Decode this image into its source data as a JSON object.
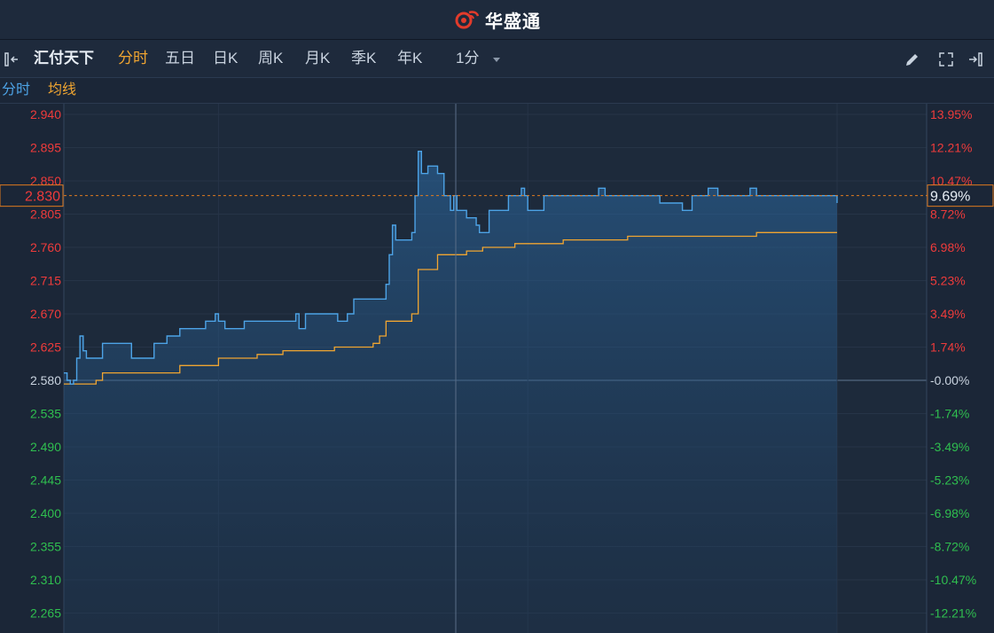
{
  "header": {
    "logo_text": "华盛通"
  },
  "toolbar": {
    "stock_name": "汇付天下",
    "tabs": [
      "分时",
      "五日",
      "日K",
      "周K",
      "月K",
      "季K",
      "年K"
    ],
    "active_tab": "分时",
    "interval": "1分"
  },
  "legend": {
    "price_label": "分时",
    "avg_label": "均线"
  },
  "colors": {
    "up": "#ef3b3b",
    "down": "#2fbf4f",
    "price_line": "#4da3e6",
    "avg_line": "#f0a531",
    "background": "#1b2637"
  },
  "chart_data": {
    "type": "line",
    "prev_close": 2.58,
    "current_price_label": "2.830",
    "current_pct_label": "9.69%",
    "y_tick_labels": [
      "2.940",
      "2.895",
      "2.850",
      "2.805",
      "2.760",
      "2.715",
      "2.670",
      "2.625",
      "2.580",
      "2.535",
      "2.490",
      "2.445",
      "2.400",
      "2.355",
      "2.310",
      "2.265"
    ],
    "pct_tick_labels": [
      "13.95%",
      "12.21%",
      "10.47%",
      "8.72%",
      "6.98%",
      "5.23%",
      "3.49%",
      "1.74%",
      "-0.00%",
      "-1.74%",
      "-3.49%",
      "-5.23%",
      "-6.98%",
      "-8.72%",
      "-10.47%",
      "-12.21%"
    ],
    "ylim": [
      2.25,
      2.94
    ],
    "total_minutes": 240,
    "series": [
      {
        "name": "分时",
        "points": [
          [
            0,
            2.59
          ],
          [
            1,
            2.58
          ],
          [
            2,
            2.575
          ],
          [
            3,
            2.58
          ],
          [
            4,
            2.61
          ],
          [
            5,
            2.64
          ],
          [
            6,
            2.62
          ],
          [
            7,
            2.61
          ],
          [
            10,
            2.61
          ],
          [
            12,
            2.63
          ],
          [
            20,
            2.63
          ],
          [
            21,
            2.61
          ],
          [
            27,
            2.61
          ],
          [
            28,
            2.63
          ],
          [
            32,
            2.64
          ],
          [
            36,
            2.65
          ],
          [
            44,
            2.66
          ],
          [
            47,
            2.67
          ],
          [
            48,
            2.66
          ],
          [
            50,
            2.65
          ],
          [
            56,
            2.66
          ],
          [
            71,
            2.66
          ],
          [
            72,
            2.67
          ],
          [
            73,
            2.65
          ],
          [
            75,
            2.67
          ],
          [
            84,
            2.67
          ],
          [
            85,
            2.66
          ],
          [
            88,
            2.67
          ],
          [
            90,
            2.69
          ],
          [
            98,
            2.69
          ],
          [
            100,
            2.71
          ],
          [
            101,
            2.75
          ],
          [
            102,
            2.79
          ],
          [
            103,
            2.77
          ],
          [
            106,
            2.77
          ],
          [
            108,
            2.78
          ],
          [
            109,
            2.83
          ],
          [
            110,
            2.89
          ],
          [
            111,
            2.86
          ],
          [
            113,
            2.87
          ],
          [
            116,
            2.86
          ],
          [
            118,
            2.83
          ],
          [
            120,
            2.81
          ],
          [
            121,
            2.83
          ],
          [
            122,
            2.81
          ],
          [
            125,
            2.8
          ],
          [
            128,
            2.79
          ],
          [
            129,
            2.78
          ],
          [
            132,
            2.81
          ],
          [
            137,
            2.81
          ],
          [
            138,
            2.83
          ],
          [
            142,
            2.84
          ],
          [
            143,
            2.83
          ],
          [
            144,
            2.81
          ],
          [
            146,
            2.81
          ],
          [
            149,
            2.83
          ],
          [
            158,
            2.83
          ],
          [
            165,
            2.83
          ],
          [
            166,
            2.84
          ],
          [
            168,
            2.83
          ],
          [
            175,
            2.83
          ],
          [
            184,
            2.83
          ],
          [
            185,
            2.82
          ],
          [
            191,
            2.82
          ],
          [
            192,
            2.81
          ],
          [
            195,
            2.83
          ],
          [
            200,
            2.84
          ],
          [
            203,
            2.83
          ],
          [
            212,
            2.83
          ],
          [
            213,
            2.84
          ],
          [
            215,
            2.83
          ],
          [
            240,
            2.82
          ]
        ]
      },
      {
        "name": "均线",
        "points": [
          [
            0,
            2.575
          ],
          [
            10,
            2.58
          ],
          [
            12,
            2.59
          ],
          [
            28,
            2.59
          ],
          [
            36,
            2.6
          ],
          [
            48,
            2.61
          ],
          [
            60,
            2.615
          ],
          [
            68,
            2.62
          ],
          [
            84,
            2.625
          ],
          [
            96,
            2.63
          ],
          [
            98,
            2.64
          ],
          [
            100,
            2.66
          ],
          [
            108,
            2.67
          ],
          [
            110,
            2.73
          ],
          [
            116,
            2.75
          ],
          [
            125,
            2.755
          ],
          [
            130,
            2.76
          ],
          [
            140,
            2.765
          ],
          [
            155,
            2.77
          ],
          [
            175,
            2.775
          ],
          [
            215,
            2.78
          ],
          [
            240,
            2.78
          ]
        ]
      }
    ]
  }
}
